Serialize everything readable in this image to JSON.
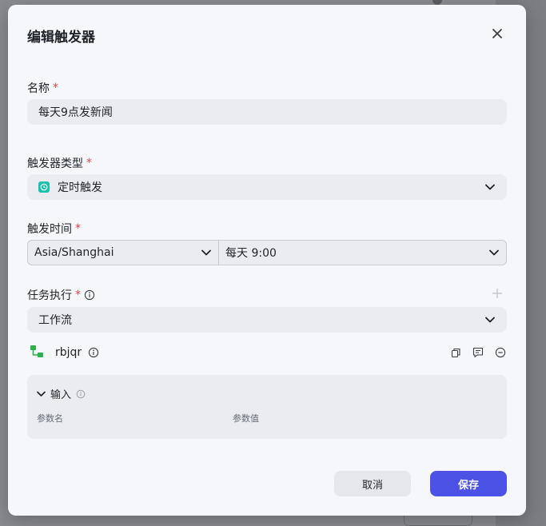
{
  "dialog": {
    "title": "编辑触发器",
    "required_mark": "*"
  },
  "name_field": {
    "label": "名称",
    "value": "每天9点发新闻"
  },
  "trigger_type": {
    "label": "触发器类型",
    "value": "定时触发",
    "icon": "clock-icon"
  },
  "trigger_time": {
    "label": "触发时间",
    "timezone": "Asia/Shanghai",
    "schedule": "每天 9:00"
  },
  "task": {
    "label": "任务执行",
    "type_value": "工作流",
    "workflow_name": "rbjqr",
    "workflow_icon": "workflow-icon"
  },
  "input_panel": {
    "title": "输入",
    "col_param_name": "参数名",
    "col_param_value": "参数值"
  },
  "buttons": {
    "cancel": "取消",
    "save": "保存"
  },
  "colors": {
    "accent": "#4b52e5",
    "required": "#e54545",
    "timer_icon": "#1fbfae",
    "workflow_icon": "#2bb24c"
  }
}
